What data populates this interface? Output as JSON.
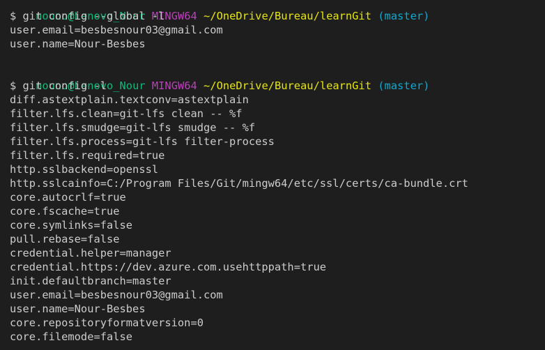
{
  "colors": {
    "background": "#1e1e1e",
    "text": "#cccccc",
    "user_host": "#0dbc79",
    "shell": "#bc3fbc",
    "path": "#e5e510",
    "branch": "#11a8cd"
  },
  "blocks": [
    {
      "prompt": {
        "user_host": "nouno@Lenovo_Nour",
        "shell": "MINGW64",
        "path": "~/OneDrive/Bureau/learnGit",
        "branch": "(master)"
      },
      "command": "$ git config --global -l",
      "output": [
        "user.email=besbesnour03@gmail.com",
        "user.name=Nour-Besbes"
      ]
    },
    {
      "prompt": {
        "user_host": "nouno@Lenovo_Nour",
        "shell": "MINGW64",
        "path": "~/OneDrive/Bureau/learnGit",
        "branch": "(master)"
      },
      "command": "$ git config -l",
      "output": [
        "diff.astextplain.textconv=astextplain",
        "filter.lfs.clean=git-lfs clean -- %f",
        "filter.lfs.smudge=git-lfs smudge -- %f",
        "filter.lfs.process=git-lfs filter-process",
        "filter.lfs.required=true",
        "http.sslbackend=openssl",
        "http.sslcainfo=C:/Program Files/Git/mingw64/etc/ssl/certs/ca-bundle.crt",
        "core.autocrlf=true",
        "core.fscache=true",
        "core.symlinks=false",
        "pull.rebase=false",
        "credential.helper=manager",
        "credential.https://dev.azure.com.usehttppath=true",
        "init.defaultbranch=master",
        "user.email=besbesnour03@gmail.com",
        "user.name=Nour-Besbes",
        "core.repositoryformatversion=0",
        "core.filemode=false"
      ]
    }
  ]
}
